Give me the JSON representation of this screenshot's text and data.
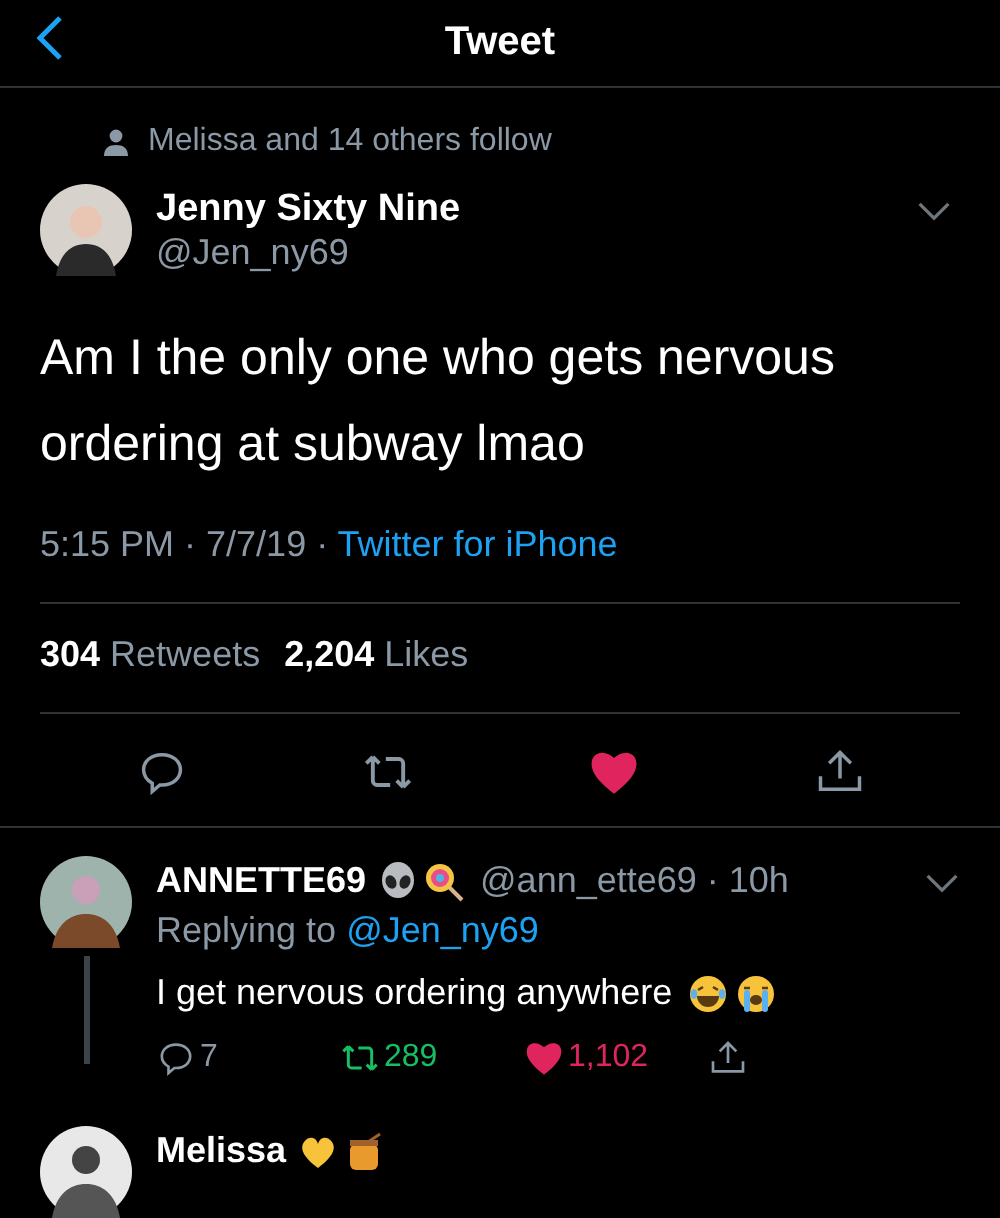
{
  "header": {
    "title": "Tweet"
  },
  "social_context": "Melissa and 14 others follow",
  "tweet": {
    "name": "Jenny Sixty Nine",
    "handle": "@Jen_ny69",
    "text": "Am I the only one who gets nervous ordering at subway lmao",
    "time": "5:15 PM · 7/7/19 · ",
    "source": "Twitter for iPhone",
    "retweets": "304",
    "retweets_label": "Retweets",
    "likes": "2,204",
    "likes_label": "Likes",
    "liked": true,
    "retweeted": false
  },
  "replies": [
    {
      "name": "ANNETTE69",
      "emojis": [
        {
          "kind": "alien"
        },
        {
          "kind": "lollipop"
        }
      ],
      "handle": "@ann_ette69 · 10h",
      "replying_label": "Replying to",
      "replying_to": "@Jen_ny69",
      "text": "I get nervous ordering anywhere",
      "text_emojis": [
        {
          "kind": "joy"
        },
        {
          "kind": "sob"
        }
      ],
      "replies": "7",
      "retweets": "289",
      "likes": "1,102",
      "liked": true,
      "retweeted": true,
      "thread": true
    },
    {
      "name": "Melissa",
      "emojis": [
        {
          "kind": "heart"
        },
        {
          "kind": "honey"
        }
      ],
      "thread": false
    }
  ]
}
